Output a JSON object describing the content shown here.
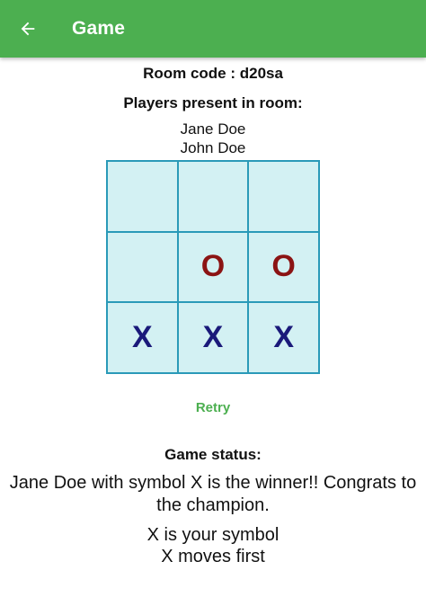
{
  "app_bar": {
    "title": "Game",
    "color": "#4CAF50",
    "back_icon": "arrow-left-icon"
  },
  "room": {
    "code_text": "Room code : d20sa"
  },
  "players": {
    "heading": "Players present in room:",
    "names": [
      "Jane Doe",
      "John Doe"
    ]
  },
  "board": {
    "cells": [
      "",
      "",
      "",
      "",
      "O",
      "O",
      "X",
      "X",
      "X"
    ]
  },
  "retry_label": "Retry",
  "status": {
    "heading": "Game status:",
    "message": "Jane Doe with symbol X is the winner!! Congrats to the champion.",
    "your_symbol": "X is your symbol",
    "first_move": "X moves first"
  }
}
